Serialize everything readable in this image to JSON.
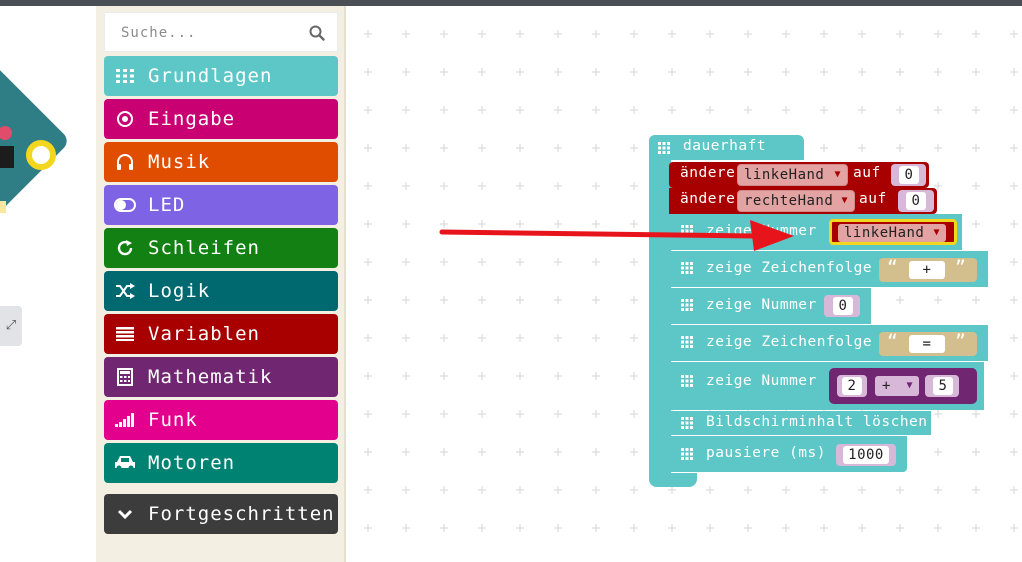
{
  "search": {
    "placeholder": "Suche..."
  },
  "categories": [
    {
      "label": "Grundlagen",
      "color": "#5cc7c6",
      "icon": "grid-icon"
    },
    {
      "label": "Eingabe",
      "color": "#c90072",
      "icon": "target-icon"
    },
    {
      "label": "Musik",
      "color": "#e04c00",
      "icon": "headphones-icon"
    },
    {
      "label": "LED",
      "color": "#7e64e4",
      "icon": "toggle-icon"
    },
    {
      "label": "Schleifen",
      "color": "#128012",
      "icon": "refresh-icon"
    },
    {
      "label": "Logik",
      "color": "#006970",
      "icon": "shuffle-icon"
    },
    {
      "label": "Variablen",
      "color": "#a80000",
      "icon": "list-icon"
    },
    {
      "label": "Mathematik",
      "color": "#712672",
      "icon": "calculator-icon"
    },
    {
      "label": "Funk",
      "color": "#e3008c",
      "icon": "signal-icon"
    },
    {
      "label": "Motoren",
      "color": "#008272",
      "icon": "car-icon"
    },
    {
      "label": "Fortgeschritten",
      "color": "#3c3c3c",
      "icon": "chevron-down-icon"
    }
  ],
  "program": {
    "event_label": "dauerhaft",
    "set1": {
      "prefix": "ändere",
      "variable": "linkeHand",
      "suffix": "auf",
      "value": "0"
    },
    "set2": {
      "prefix": "ändere",
      "variable": "rechteHand",
      "suffix": "auf",
      "value": "0"
    },
    "show_number_1": {
      "label": "zeige Nummer",
      "variable": "linkeHand"
    },
    "show_string_1": {
      "label": "zeige Zeichenfolge",
      "value": "+"
    },
    "show_number_2": {
      "label": "zeige Nummer",
      "value": "0"
    },
    "show_string_2": {
      "label": "zeige Zeichenfolge",
      "value": "="
    },
    "show_number_3": {
      "label": "zeige Nummer",
      "left": "2",
      "operator": "+",
      "right": "5"
    },
    "clear_screen": {
      "label": "Bildschirminhalt löschen"
    },
    "pause": {
      "label": "pausiere (ms)",
      "value": "1000"
    }
  },
  "colors": {
    "basic": "#5cc7c6",
    "variables": "#a80000",
    "math": "#712672",
    "text": "#d3bf8e",
    "highlight": "#f3d71e",
    "arrow": "#e8141c"
  }
}
